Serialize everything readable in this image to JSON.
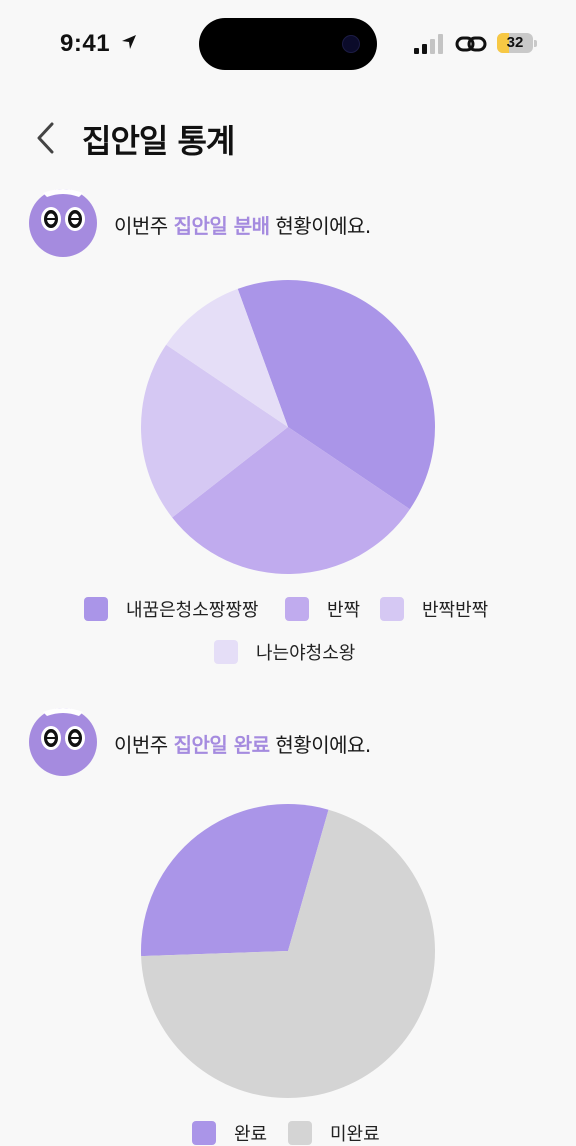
{
  "status_bar": {
    "time": "9:41",
    "battery": "32",
    "battery_level": 0.32,
    "icons": [
      "location-arrow-icon",
      "signal-icon",
      "link-icon",
      "battery-icon"
    ]
  },
  "header": {
    "title": "집안일 통계",
    "back_icon": "chevron-left-icon"
  },
  "sections": [
    {
      "caption_pre": "이번주 ",
      "caption_highlight": "집안일 분배",
      "caption_post": " 현황이에요.",
      "chart_data": {
        "type": "pie",
        "categories": [
          "내꿈은청소짱짱짱",
          "반짝",
          "반짝반짝",
          "나는야청소왕"
        ],
        "values": [
          40,
          30,
          20,
          10
        ],
        "colors": [
          "#aa95e8",
          "#c0abee",
          "#d5c8f3",
          "#e5def7"
        ]
      }
    },
    {
      "caption_pre": "이번주 ",
      "caption_highlight": "집안일 완료",
      "caption_post": " 현황이에요.",
      "chart_data": {
        "type": "pie",
        "categories": [
          "완료",
          "미완료"
        ],
        "values": [
          30,
          70
        ],
        "colors": [
          "#aa95e8",
          "#d4d4d4"
        ]
      }
    }
  ],
  "colors": {
    "accent": "#a58bdf",
    "background": "#f8f8f8",
    "avatar": "#a58bdf"
  }
}
